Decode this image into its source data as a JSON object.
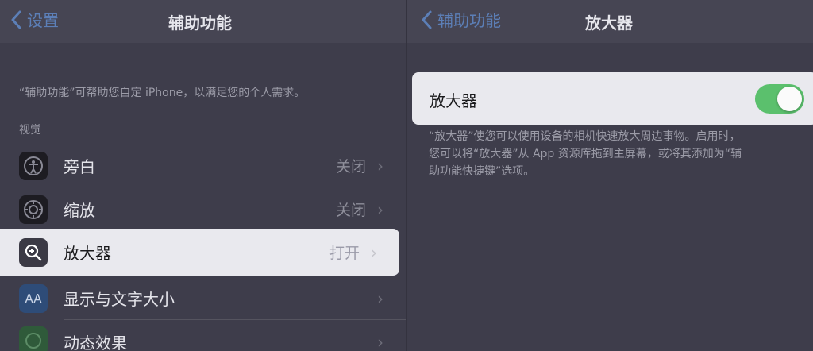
{
  "left": {
    "back_label": "设置",
    "title": "辅助功能",
    "description": "“辅助功能”可帮助您自定 iPhone，以满足您的个人需求。",
    "section_header": "视觉",
    "rows": [
      {
        "label": "旁白",
        "value": "关闭",
        "icon": "voiceover-icon"
      },
      {
        "label": "缩放",
        "value": "关闭",
        "icon": "zoom-icon"
      },
      {
        "label": "放大器",
        "value": "打开",
        "icon": "magnifier-icon"
      },
      {
        "label": "显示与文字大小",
        "value": "",
        "icon": "text-size-icon",
        "icon_text": "AA"
      },
      {
        "label": "动态效果",
        "value": "",
        "icon": "motion-icon"
      }
    ]
  },
  "right": {
    "back_label": "辅助功能",
    "title": "放大器",
    "toggle_label": "放大器",
    "toggle_on": true,
    "description_lines": [
      "“放大器”使您可以使用设备的相机快速放大周边事物。启用时，",
      "您可以将“放大器”从 App 资源库拖到主屏幕，或将其添加为“辅",
      "助功能快捷键”选项。"
    ]
  },
  "colors": {
    "accent": "#5c7fb7",
    "toggle_on": "#5bc06d",
    "highlight_row": "#e9e9ee",
    "background": "#3e3d4b"
  }
}
